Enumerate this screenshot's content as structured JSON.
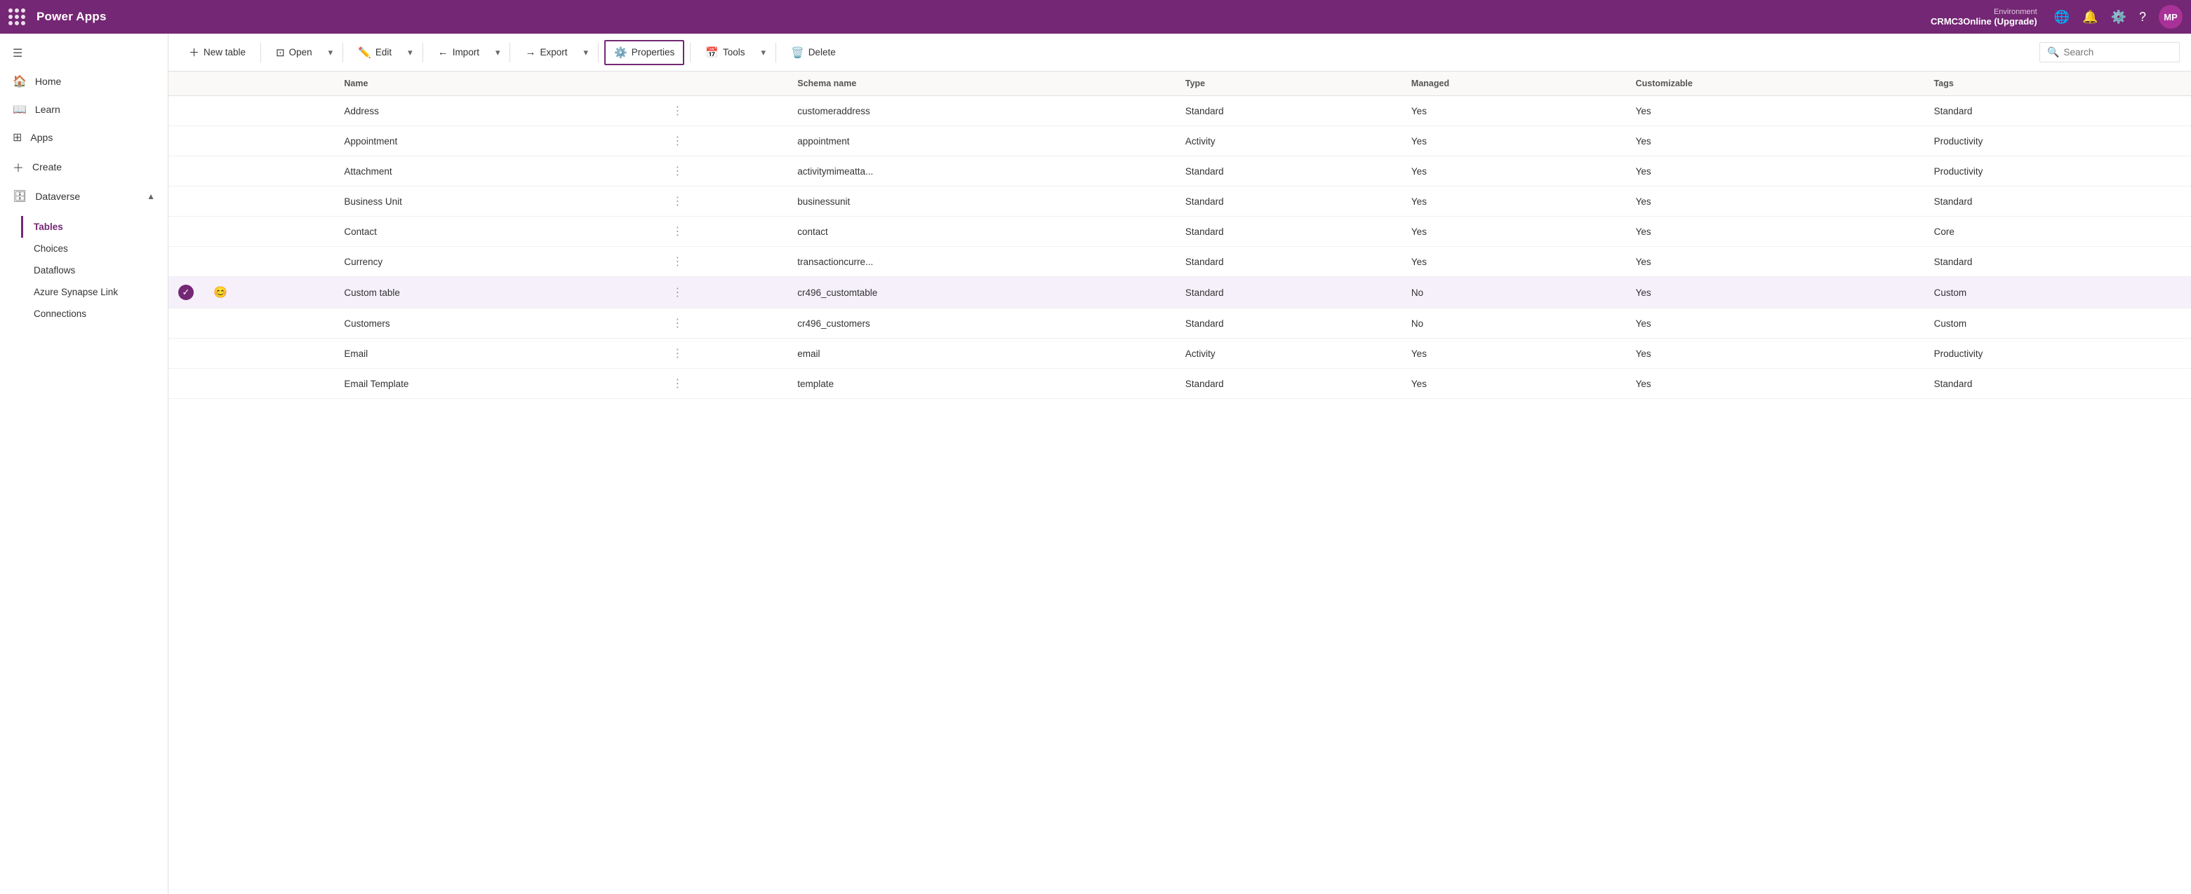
{
  "topbar": {
    "logo": "Power Apps",
    "environment_label": "Environment",
    "environment_name": "CRMC3Online (Upgrade)",
    "avatar_initials": "MP"
  },
  "sidebar": {
    "hamburger_label": "Toggle navigation",
    "items": [
      {
        "id": "home",
        "label": "Home",
        "icon": "🏠"
      },
      {
        "id": "learn",
        "label": "Learn",
        "icon": "📖"
      },
      {
        "id": "apps",
        "label": "Apps",
        "icon": "⊞"
      },
      {
        "id": "create",
        "label": "Create",
        "icon": "➕"
      },
      {
        "id": "dataverse",
        "label": "Dataverse",
        "icon": "🗄",
        "expanded": true
      }
    ],
    "dataverse_children": [
      {
        "id": "tables",
        "label": "Tables",
        "active": true
      },
      {
        "id": "choices",
        "label": "Choices"
      },
      {
        "id": "dataflows",
        "label": "Dataflows"
      },
      {
        "id": "azure-synapse",
        "label": "Azure Synapse Link"
      },
      {
        "id": "connections",
        "label": "Connections"
      }
    ]
  },
  "toolbar": {
    "new_table_label": "New table",
    "open_label": "Open",
    "edit_label": "Edit",
    "import_label": "Import",
    "export_label": "Export",
    "properties_label": "Properties",
    "tools_label": "Tools",
    "delete_label": "Delete",
    "search_placeholder": "Search"
  },
  "table": {
    "columns": [
      "",
      "",
      "Name",
      "",
      "Schema name",
      "Type",
      "Managed",
      "Customizable",
      "Tags"
    ],
    "rows": [
      {
        "name": "Address",
        "schema": "customeraddress",
        "type": "Standard",
        "managed": "Yes",
        "customizable": "Yes",
        "tags": "Standard",
        "selected": false,
        "check": false,
        "emoji": ""
      },
      {
        "name": "Appointment",
        "schema": "appointment",
        "type": "Activity",
        "managed": "Yes",
        "customizable": "Yes",
        "tags": "Productivity",
        "selected": false,
        "check": false,
        "emoji": ""
      },
      {
        "name": "Attachment",
        "schema": "activitymimeatta...",
        "type": "Standard",
        "managed": "Yes",
        "customizable": "Yes",
        "tags": "Productivity",
        "selected": false,
        "check": false,
        "emoji": ""
      },
      {
        "name": "Business Unit",
        "schema": "businessunit",
        "type": "Standard",
        "managed": "Yes",
        "customizable": "Yes",
        "tags": "Standard",
        "selected": false,
        "check": false,
        "emoji": ""
      },
      {
        "name": "Contact",
        "schema": "contact",
        "type": "Standard",
        "managed": "Yes",
        "customizable": "Yes",
        "tags": "Core",
        "selected": false,
        "check": false,
        "emoji": ""
      },
      {
        "name": "Currency",
        "schema": "transactioncurre...",
        "type": "Standard",
        "managed": "Yes",
        "customizable": "Yes",
        "tags": "Standard",
        "selected": false,
        "check": false,
        "emoji": ""
      },
      {
        "name": "Custom table",
        "schema": "cr496_customtable",
        "type": "Standard",
        "managed": "No",
        "customizable": "Yes",
        "tags": "Custom",
        "selected": true,
        "check": true,
        "emoji": "😊"
      },
      {
        "name": "Customers",
        "schema": "cr496_customers",
        "type": "Standard",
        "managed": "No",
        "customizable": "Yes",
        "tags": "Custom",
        "selected": false,
        "check": false,
        "emoji": ""
      },
      {
        "name": "Email",
        "schema": "email",
        "type": "Activity",
        "managed": "Yes",
        "customizable": "Yes",
        "tags": "Productivity",
        "selected": false,
        "check": false,
        "emoji": ""
      },
      {
        "name": "Email Template",
        "schema": "template",
        "type": "Standard",
        "managed": "Yes",
        "customizable": "Yes",
        "tags": "Standard",
        "selected": false,
        "check": false,
        "emoji": ""
      }
    ]
  }
}
